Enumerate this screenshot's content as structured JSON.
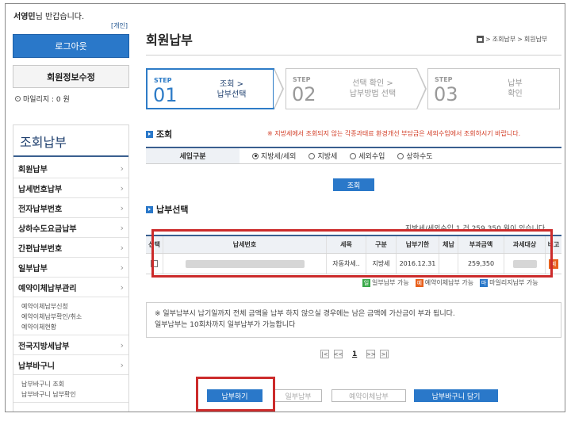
{
  "user": {
    "name": "서영민",
    "greeting_suffix": "님 반갑습니다.",
    "personal_tag": "[개인]"
  },
  "account": {
    "logout_label": "로그아웃",
    "edit_info_label": "회원정보수정",
    "mileage": "마일리지 : 0 원"
  },
  "left_nav": {
    "title": "조회납부",
    "items": [
      {
        "label": "회원납부",
        "chev": "›"
      },
      {
        "label": "납세번호납부",
        "chev": "›"
      },
      {
        "label": "전자납부번호",
        "chev": "›"
      },
      {
        "label": "상하수도요금납부",
        "chev": "›"
      },
      {
        "label": "간편납부번호",
        "chev": "›"
      },
      {
        "label": "일부납부",
        "chev": "›"
      },
      {
        "label": "예약이체납부관리",
        "chev": "›"
      },
      {
        "label": "전국지방세납부",
        "chev": "›"
      },
      {
        "label": "납부바구니",
        "chev": "›"
      }
    ],
    "sub_reservation": [
      "예약이체납부신청",
      "예약이체납부확인/취소",
      "예약이체현황"
    ],
    "sub_basket": [
      "납부바구니 조회",
      "납부바구니 납부확인"
    ]
  },
  "header": {
    "title": "회원납부",
    "breadcrumb": [
      "조회납부",
      "회원납부"
    ],
    "breadcrumb_sep": ">"
  },
  "steps": [
    {
      "label": "STEP",
      "num": "01",
      "text": "조회 >\n납부선택",
      "active": true
    },
    {
      "label": "STEP",
      "num": "02",
      "text": "선택 확인 >\n납부방법 선택",
      "active": false
    },
    {
      "label": "STEP",
      "num": "03",
      "text": "납부\n확인",
      "active": false
    }
  ],
  "query_section": {
    "title": "조회",
    "notice": "※ 지방세에서 조회되지 않는 각종과태료 환경개선 부담금은 세외수입에서 조회하시기 바랍니다.",
    "filter_label": "세입구분",
    "options": [
      {
        "label": "지방세/세외",
        "selected": true
      },
      {
        "label": "지방세",
        "selected": false
      },
      {
        "label": "세외수입",
        "selected": false
      },
      {
        "label": "상하수도",
        "selected": false
      }
    ],
    "query_button": "조회"
  },
  "payment_section": {
    "title": "납부선택",
    "count_text": "지방세/세외수입 1 건 259,350 원이 있습니다.",
    "columns": [
      "선택",
      "납세번호",
      "세목",
      "구분",
      "납부기한",
      "체납",
      "부과금액",
      "과세대상",
      "비고"
    ],
    "rows": [
      {
        "tax_item": "자동차세..",
        "kind": "지방세",
        "due": "2016.12.31",
        "arrears": "",
        "amount": "259,350",
        "note_badge": "예"
      }
    ],
    "legend": [
      {
        "key": "일",
        "text": "일부납부 가능",
        "color": "#3aa94a"
      },
      {
        "key": "예",
        "text": "예약이체납부 가능",
        "color": "#e8601c"
      },
      {
        "key": "마",
        "text": "마일리지납부 가능",
        "color": "#2a78c9"
      }
    ]
  },
  "info_text": [
    "※ 일부납부시 납기일까지 전체 금액을 납부 하지 않으실 경우에는 남은 금액에 가산금이 부과 됩니다.",
    "일부납부는 10회차까지 일부납부가 가능합니다"
  ],
  "pager": {
    "first": "|<",
    "prev": "<<",
    "current": "1",
    "next": ">>",
    "last": ">|"
  },
  "actions": {
    "pay": "납부하기",
    "partial": "일부납부",
    "reserve": "예약이체납부",
    "basket": "납부바구니 담기"
  },
  "colors": {
    "accent": "#2a78c9",
    "highlight": "#cc2b2b",
    "notice": "#d23b24"
  }
}
